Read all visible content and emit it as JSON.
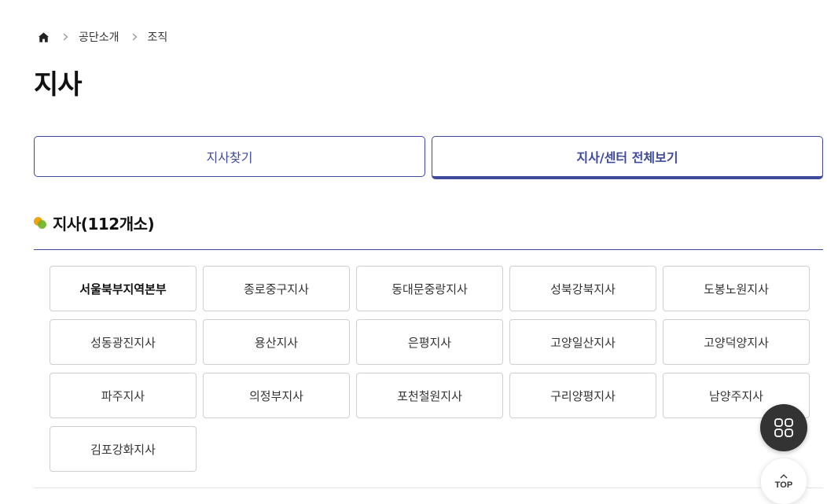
{
  "breadcrumb": {
    "home_icon": "home-icon",
    "items": [
      "공단소개",
      "조직"
    ]
  },
  "page": {
    "title": "지사"
  },
  "tabs": [
    {
      "label": "지사찾기",
      "active": false
    },
    {
      "label": "지사/센터 전체보기",
      "active": true
    }
  ],
  "section": {
    "title": "지사(112개소)"
  },
  "branches": [
    "서울북부지역본부",
    "종로중구지사",
    "동대문중랑지사",
    "성북강북지사",
    "도봉노원지사",
    "성동광진지사",
    "용산지사",
    "은평지사",
    "고양일산지사",
    "고양덕양지사",
    "파주지사",
    "의정부지사",
    "포천철원지사",
    "구리양평지사",
    "남양주지사",
    "김포강화지사"
  ],
  "floating": {
    "menu_icon": "grid-menu-icon",
    "top_label": "TOP"
  },
  "colors": {
    "accent": "#3f4a9d",
    "dot_orange": "#f0a30a",
    "dot_green": "#71b42b",
    "fab_dark": "#333333"
  }
}
